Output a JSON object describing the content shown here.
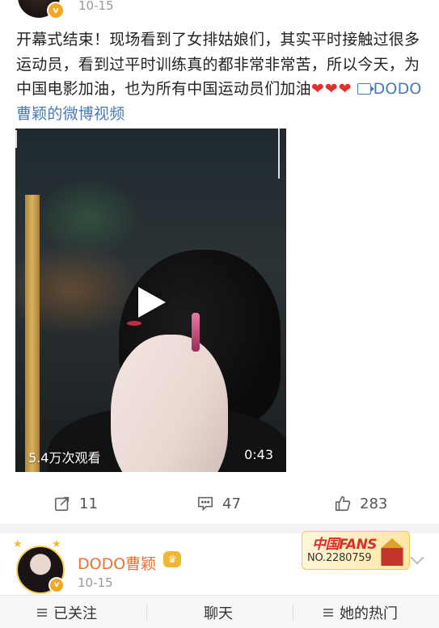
{
  "post": {
    "time": "10-15",
    "text_main": "开幕式结束！现场看到了女排姑娘们，其实平时接触过很多运动员，看到过平时训练真的都非常非常苦，所以今天，为中国电影加油，也为所有中国运动员们加油",
    "hearts": "❤❤❤",
    "video_link": "DODO曹颖的微博视频",
    "video": {
      "views": "5.4万次观看",
      "duration": "0:43"
    },
    "actions": {
      "repost_count": "11",
      "comment_count": "47",
      "like_count": "283"
    }
  },
  "profile": {
    "name": "DODO曹颖",
    "time": "10-15",
    "fans_badge_title": "中国FANS",
    "fans_badge_no": "NO.2280759"
  },
  "bottom_bar": {
    "follow": "已关注",
    "chat": "聊天",
    "hot": "她的热门"
  },
  "colors": {
    "link": "#4a7ab8",
    "name_orange": "#e8723a",
    "heart_red": "#e0312f",
    "verified_gold": "#f5a623"
  },
  "icons": [
    "verified-badge-icon",
    "video-camera-icon",
    "play-icon",
    "repost-icon",
    "comment-icon",
    "like-icon",
    "crown-icon",
    "chevron-down-icon",
    "menu-icon"
  ]
}
